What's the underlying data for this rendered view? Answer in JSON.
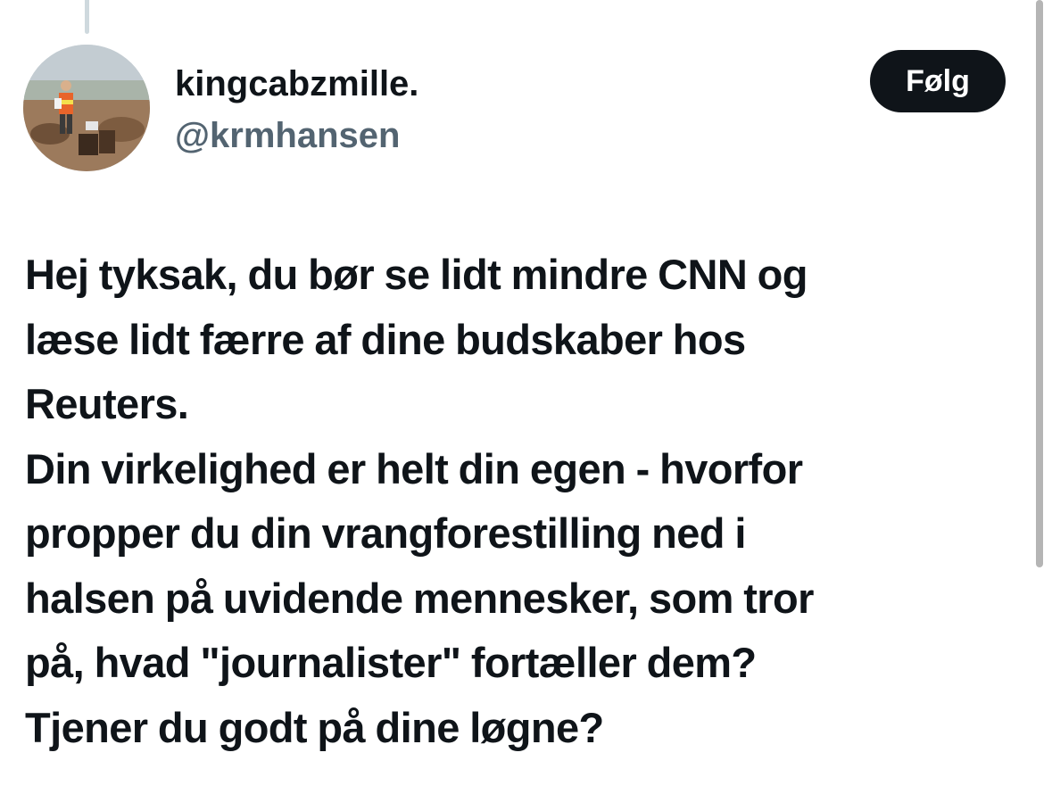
{
  "user": {
    "display_name": "kingcabzmille.",
    "handle": "@krmhansen",
    "avatar_icon": "profile-photo-avatar"
  },
  "follow_button": {
    "label": "Følg"
  },
  "tweet": {
    "lines": [
      "Hej tyksak, du bør se lidt mindre CNN og",
      "læse lidt færre af dine budskaber hos",
      "Reuters.",
      "Din virkelighed er helt din egen - hvorfor",
      "propper du din vrangforestilling ned i",
      "halsen på uvidende mennesker, som tror",
      "på, hvad \"journalister\" fortæller dem?",
      "Tjener du godt på dine løgne?"
    ]
  },
  "colors": {
    "text": "#0f1419",
    "secondary_text": "#536471",
    "button_bg": "#0f1419",
    "button_text": "#ffffff"
  }
}
